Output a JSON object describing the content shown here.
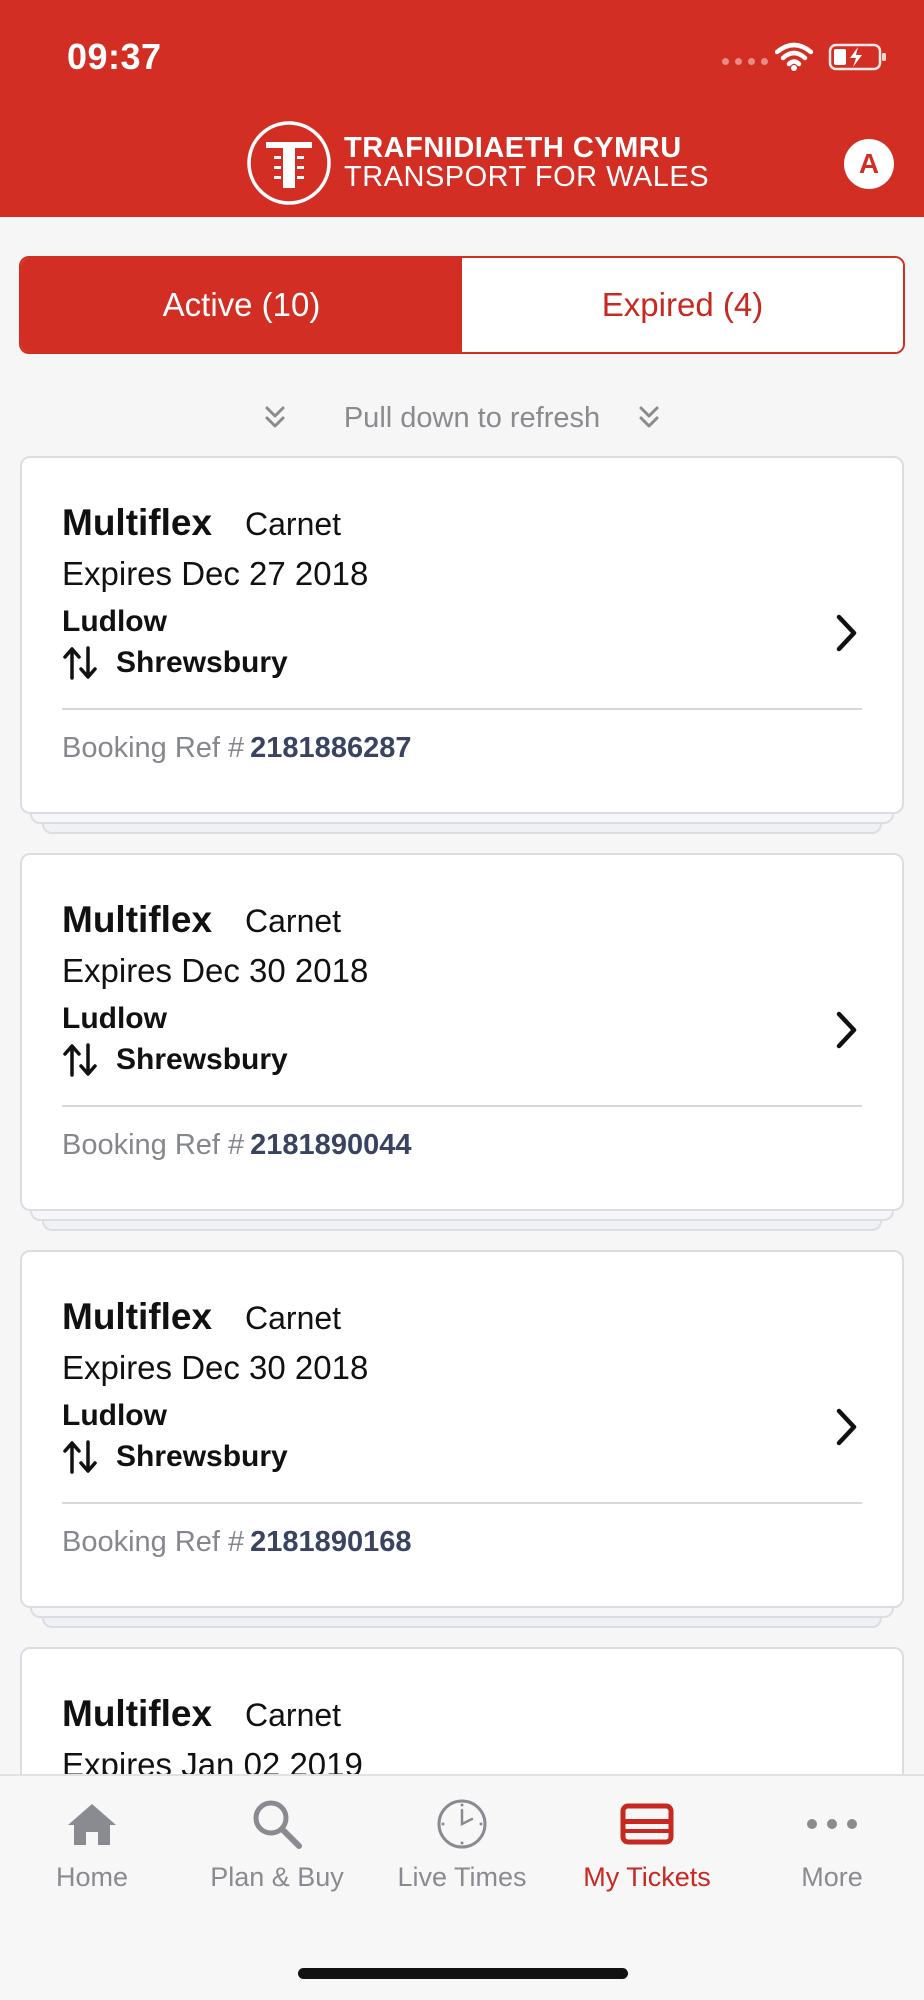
{
  "status_bar": {
    "time": "09:37"
  },
  "header": {
    "logo_line1": "TRAFNIDIAETH CYMRU",
    "logo_line2": "TRANSPORT FOR WALES",
    "account_initial": "A",
    "brand_color": "#d32e24"
  },
  "segment": {
    "active_label": "Active (10)",
    "expired_label": "Expired (4)"
  },
  "refresh": {
    "label": "Pull down to refresh"
  },
  "tickets": [
    {
      "name": "Multiflex",
      "type": "Carnet",
      "expires": "Expires Dec 27 2018",
      "origin": "Ludlow",
      "destination": "Shrewsbury",
      "booking_label": "Booking Ref #",
      "booking_ref": "2181886287"
    },
    {
      "name": "Multiflex",
      "type": "Carnet",
      "expires": "Expires Dec 30 2018",
      "origin": "Ludlow",
      "destination": "Shrewsbury",
      "booking_label": "Booking Ref #",
      "booking_ref": "2181890044"
    },
    {
      "name": "Multiflex",
      "type": "Carnet",
      "expires": "Expires Dec 30 2018",
      "origin": "Ludlow",
      "destination": "Shrewsbury",
      "booking_label": "Booking Ref #",
      "booking_ref": "2181890168"
    },
    {
      "name": "Multiflex",
      "type": "Carnet",
      "expires": "Expires Jan 02 2019",
      "origin": "",
      "destination": "",
      "booking_label": "",
      "booking_ref": ""
    }
  ],
  "tabbar": {
    "items": [
      {
        "label": "Home",
        "icon": "home-icon"
      },
      {
        "label": "Plan & Buy",
        "icon": "search-icon"
      },
      {
        "label": "Live Times",
        "icon": "clock-icon"
      },
      {
        "label": "My Tickets",
        "icon": "ticket-icon",
        "active": true
      },
      {
        "label": "More",
        "icon": "more-icon"
      }
    ]
  }
}
